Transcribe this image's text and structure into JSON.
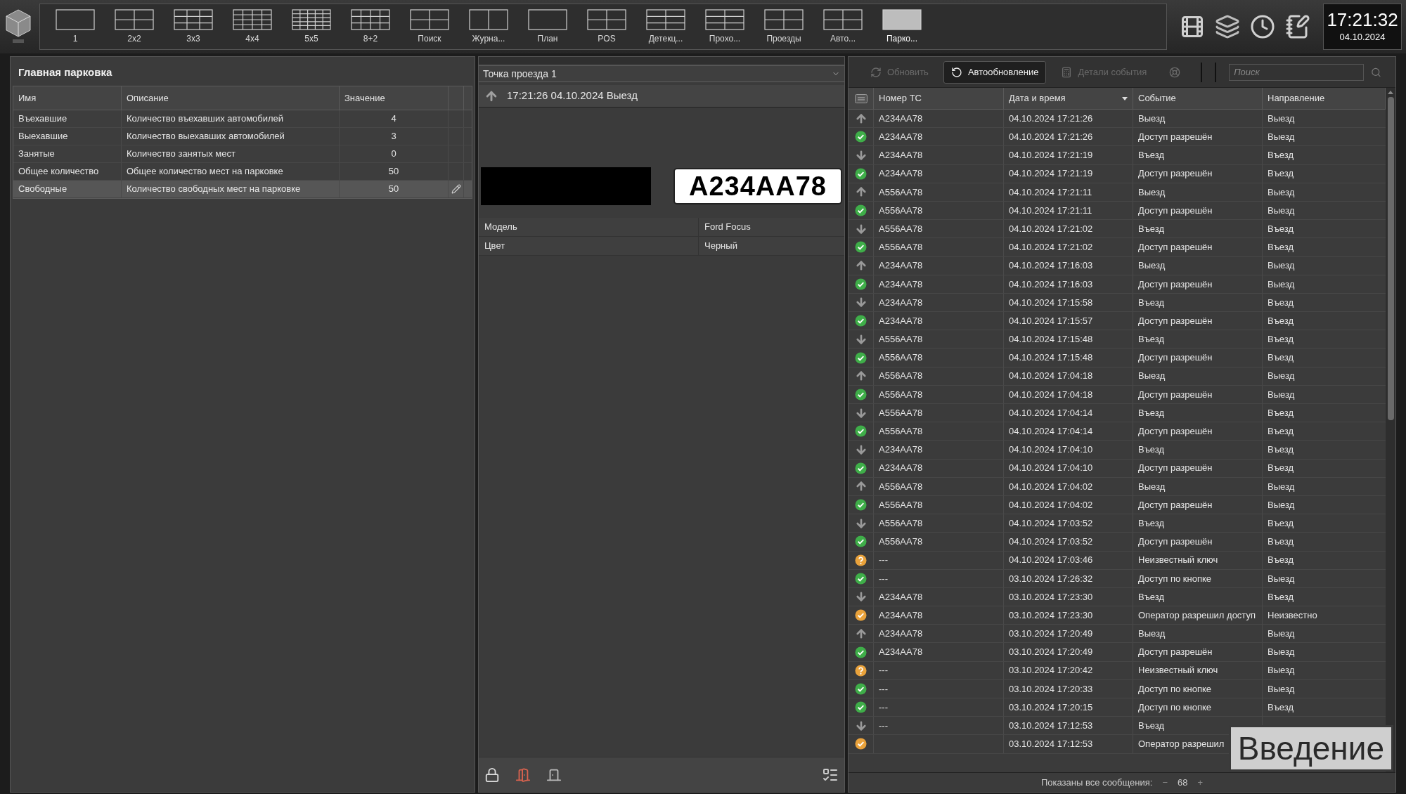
{
  "layouts": [
    {
      "label": "1",
      "selected": false
    },
    {
      "label": "2x2",
      "selected": false
    },
    {
      "label": "3x3",
      "selected": false
    },
    {
      "label": "4x4",
      "selected": false
    },
    {
      "label": "5x5",
      "selected": false
    },
    {
      "label": "8+2",
      "selected": false
    },
    {
      "label": "Поиск",
      "selected": false
    },
    {
      "label": "Журна...",
      "selected": false
    },
    {
      "label": "План",
      "selected": false
    },
    {
      "label": "POS",
      "selected": false
    },
    {
      "label": "Детекц...",
      "selected": false
    },
    {
      "label": "Прохо...",
      "selected": false
    },
    {
      "label": "Проезды",
      "selected": false
    },
    {
      "label": "Авто...",
      "selected": false
    },
    {
      "label": "Парко...",
      "selected": true
    }
  ],
  "clock": {
    "time": "17:21:32",
    "date": "04.10.2024"
  },
  "parking": {
    "title": "Главная парковка",
    "columns": [
      "Имя",
      "Описание",
      "Значение"
    ],
    "rows": [
      {
        "name": "Въехавшие",
        "description": "Количество въехавших автомобилей",
        "value": "4",
        "selected": false
      },
      {
        "name": "Выехавшие",
        "description": "Количество выехавших автомобилей",
        "value": "3",
        "selected": false
      },
      {
        "name": "Занятые",
        "description": "Количество занятых мест",
        "value": "0",
        "selected": false
      },
      {
        "name": "Общее количество",
        "description": "Общее количество мест на парковке",
        "value": "50",
        "selected": false
      },
      {
        "name": "Свободные",
        "description": "Количество свободных мест на парковке",
        "value": "50",
        "selected": true
      }
    ]
  },
  "passage": {
    "point": "Точка проезда 1",
    "event": "17:21:26 04.10.2024 Выезд",
    "plate": "A234AA78",
    "attributes": [
      {
        "label": "Модель",
        "value": "Ford Focus"
      },
      {
        "label": "Цвет",
        "value": "Черный"
      }
    ]
  },
  "events": {
    "toolbar": [
      {
        "label": "Обновить",
        "disabled": true,
        "selected": false
      },
      {
        "label": "Автообновление",
        "disabled": false,
        "selected": true
      },
      {
        "label": "Детали события",
        "disabled": true,
        "selected": false
      },
      {
        "disabled": true,
        "selected": false
      }
    ],
    "search": {
      "placeholder": "Поиск"
    },
    "columns": [
      {
        "label": "Номер ТС",
        "sorted": false
      },
      {
        "label": "Дата и время",
        "sorted": true
      },
      {
        "label": "Событие",
        "sorted": false
      },
      {
        "label": "Направление",
        "sorted": false
      }
    ],
    "rows": [
      {
        "kind": "up",
        "plate": "A234AA78",
        "time": "04.10.2024 17:21:26",
        "event": "Выезд",
        "direction": "Выезд"
      },
      {
        "kind": "ok",
        "plate": "A234AA78",
        "time": "04.10.2024 17:21:26",
        "event": "Доступ разрешён",
        "direction": "Выезд"
      },
      {
        "kind": "down",
        "plate": "A234AA78",
        "time": "04.10.2024 17:21:19",
        "event": "Въезд",
        "direction": "Въезд"
      },
      {
        "kind": "ok",
        "plate": "A234AA78",
        "time": "04.10.2024 17:21:19",
        "event": "Доступ разрешён",
        "direction": "Въезд"
      },
      {
        "kind": "up",
        "plate": "A556AA78",
        "time": "04.10.2024 17:21:11",
        "event": "Выезд",
        "direction": "Выезд"
      },
      {
        "kind": "ok",
        "plate": "A556AA78",
        "time": "04.10.2024 17:21:11",
        "event": "Доступ разрешён",
        "direction": "Выезд"
      },
      {
        "kind": "down",
        "plate": "A556AA78",
        "time": "04.10.2024 17:21:02",
        "event": "Въезд",
        "direction": "Въезд"
      },
      {
        "kind": "ok",
        "plate": "A556AA78",
        "time": "04.10.2024 17:21:02",
        "event": "Доступ разрешён",
        "direction": "Въезд"
      },
      {
        "kind": "up",
        "plate": "A234AA78",
        "time": "04.10.2024 17:16:03",
        "event": "Выезд",
        "direction": "Выезд"
      },
      {
        "kind": "ok",
        "plate": "A234AA78",
        "time": "04.10.2024 17:16:03",
        "event": "Доступ разрешён",
        "direction": "Выезд"
      },
      {
        "kind": "down",
        "plate": "A234AA78",
        "time": "04.10.2024 17:15:58",
        "event": "Въезд",
        "direction": "Въезд"
      },
      {
        "kind": "ok",
        "plate": "A234AA78",
        "time": "04.10.2024 17:15:57",
        "event": "Доступ разрешён",
        "direction": "Въезд"
      },
      {
        "kind": "down",
        "plate": "A556AA78",
        "time": "04.10.2024 17:15:48",
        "event": "Въезд",
        "direction": "Въезд"
      },
      {
        "kind": "ok",
        "plate": "A556AA78",
        "time": "04.10.2024 17:15:48",
        "event": "Доступ разрешён",
        "direction": "Въезд"
      },
      {
        "kind": "up",
        "plate": "A556AA78",
        "time": "04.10.2024 17:04:18",
        "event": "Выезд",
        "direction": "Выезд"
      },
      {
        "kind": "ok",
        "plate": "A556AA78",
        "time": "04.10.2024 17:04:18",
        "event": "Доступ разрешён",
        "direction": "Выезд"
      },
      {
        "kind": "down",
        "plate": "A556AA78",
        "time": "04.10.2024 17:04:14",
        "event": "Въезд",
        "direction": "Въезд"
      },
      {
        "kind": "ok",
        "plate": "A556AA78",
        "time": "04.10.2024 17:04:14",
        "event": "Доступ разрешён",
        "direction": "Въезд"
      },
      {
        "kind": "down",
        "plate": "A234AA78",
        "time": "04.10.2024 17:04:10",
        "event": "Въезд",
        "direction": "Въезд"
      },
      {
        "kind": "ok",
        "plate": "A234AA78",
        "time": "04.10.2024 17:04:10",
        "event": "Доступ разрешён",
        "direction": "Въезд"
      },
      {
        "kind": "up",
        "plate": "A556AA78",
        "time": "04.10.2024 17:04:02",
        "event": "Выезд",
        "direction": "Выезд"
      },
      {
        "kind": "ok",
        "plate": "A556AA78",
        "time": "04.10.2024 17:04:02",
        "event": "Доступ разрешён",
        "direction": "Выезд"
      },
      {
        "kind": "down",
        "plate": "A556AA78",
        "time": "04.10.2024 17:03:52",
        "event": "Въезд",
        "direction": "Въезд"
      },
      {
        "kind": "ok",
        "plate": "A556AA78",
        "time": "04.10.2024 17:03:52",
        "event": "Доступ разрешён",
        "direction": "Въезд"
      },
      {
        "kind": "warn",
        "plate": "---",
        "time": "04.10.2024 17:03:46",
        "event": "Неизвестный ключ",
        "direction": "Въезд"
      },
      {
        "kind": "ok",
        "plate": "---",
        "time": "03.10.2024 17:26:32",
        "event": "Доступ по кнопке",
        "direction": "Выезд"
      },
      {
        "kind": "down",
        "plate": "A234AA78",
        "time": "03.10.2024 17:23:30",
        "event": "Въезд",
        "direction": "Въезд"
      },
      {
        "kind": "operator",
        "plate": "A234AA78",
        "time": "03.10.2024 17:23:30",
        "event": "Оператор разрешил доступ",
        "direction": "Неизвестно"
      },
      {
        "kind": "up",
        "plate": "A234AA78",
        "time": "03.10.2024 17:20:49",
        "event": "Выезд",
        "direction": "Выезд"
      },
      {
        "kind": "ok",
        "plate": "A234AA78",
        "time": "03.10.2024 17:20:49",
        "event": "Доступ разрешён",
        "direction": "Выезд"
      },
      {
        "kind": "warn",
        "plate": "---",
        "time": "03.10.2024 17:20:42",
        "event": "Неизвестный ключ",
        "direction": "Выезд"
      },
      {
        "kind": "ok",
        "plate": "---",
        "time": "03.10.2024 17:20:33",
        "event": "Доступ по кнопке",
        "direction": "Выезд"
      },
      {
        "kind": "ok",
        "plate": "---",
        "time": "03.10.2024 17:20:15",
        "event": "Доступ по кнопке",
        "direction": "Въезд"
      },
      {
        "kind": "down",
        "plate": "---",
        "time": "03.10.2024 17:12:53",
        "event": "Въезд"
      },
      {
        "kind": "operator",
        "time": "03.10.2024 17:12:53",
        "event": "Оператор разрешил"
      }
    ],
    "footer": {
      "label": "Показаны все сообщения:",
      "minus": "−",
      "count": "68",
      "plus": "+"
    }
  },
  "caption": "Введение"
}
